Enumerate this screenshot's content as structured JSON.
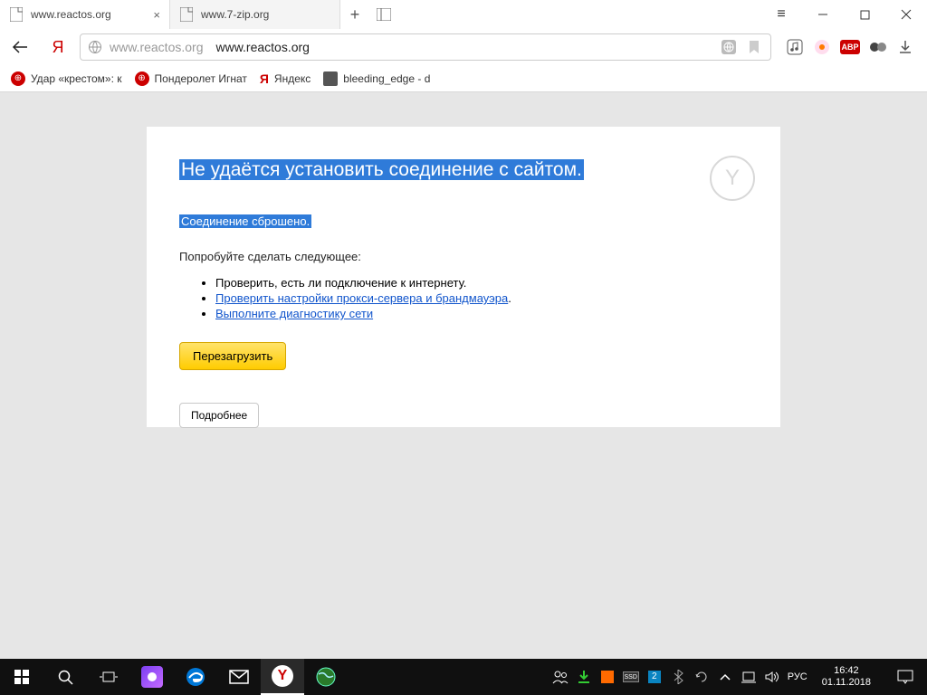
{
  "tabs": [
    {
      "title": "www.reactos.org",
      "active": true
    },
    {
      "title": "www.7-zip.org",
      "active": false
    }
  ],
  "address": {
    "display_grey": "www.reactos.org",
    "display_black": "www.reactos.org"
  },
  "bookmarks": [
    {
      "label": "Удар «крестом»: к",
      "icon": "red"
    },
    {
      "label": "Пондеролет Игнат",
      "icon": "red"
    },
    {
      "label": "Яндекс",
      "icon": "ya"
    },
    {
      "label": "bleeding_edge - d",
      "icon": "folder"
    }
  ],
  "error": {
    "title": "Не удаётся установить соединение с сайтом.",
    "subtitle": "Соединение сброшено.",
    "try_label": "Попробуйте сделать следующее:",
    "items": [
      {
        "text": "Проверить, есть ли подключение к интернету.",
        "link": false
      },
      {
        "text": "Проверить настройки прокси-сервера и брандмауэра",
        "link": true,
        "suffix": "."
      },
      {
        "text": "Выполните диагностику сети",
        "link": true
      }
    ],
    "reload": "Перезагрузить",
    "more": "Подробнее"
  },
  "tray": {
    "lang": "РУС",
    "time": "16:42",
    "date": "01.11.2018"
  },
  "ext": {
    "abp": "ABP"
  }
}
